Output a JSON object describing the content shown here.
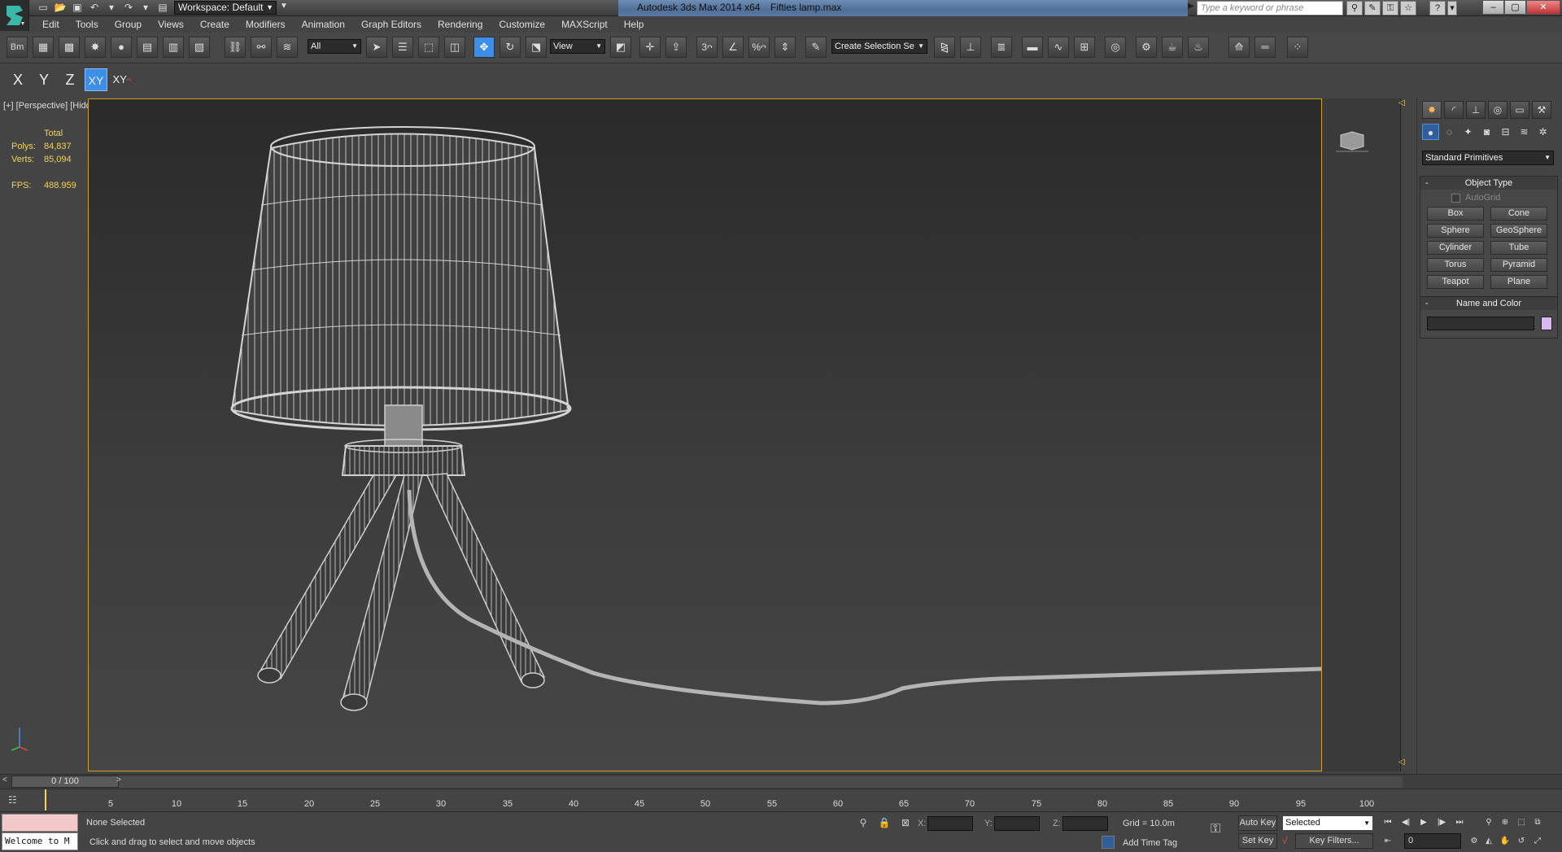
{
  "title_bar": {
    "workspace_label": "Workspace: Default",
    "app_title": "Autodesk 3ds Max  2014 x64",
    "file_title": "Fifties lamp.max",
    "search_placeholder": "Type a keyword or phrase",
    "title_accent": "#5b7aa4"
  },
  "menu": {
    "items": [
      "Edit",
      "Tools",
      "Group",
      "Views",
      "Create",
      "Modifiers",
      "Animation",
      "Graph Editors",
      "Rendering",
      "Customize",
      "MAXScript",
      "Help"
    ]
  },
  "main_toolbar": {
    "selection_filter": "All",
    "reference_coord": "View",
    "named_selection": "Create Selection Se",
    "active_tool_color": "#3d8ee8"
  },
  "axis_constraints": {
    "x": "X",
    "y": "Y",
    "z": "Z",
    "xy": "XY",
    "xy_cycle": "XY"
  },
  "viewport": {
    "label": "[+] [Perspective] [Hidden Line]",
    "stats": {
      "header": "Total",
      "polys_label": "Polys:",
      "polys_value": "84,837",
      "verts_label": "Verts:",
      "verts_value": "85,094",
      "fps_label": "FPS:",
      "fps_value": "488.959"
    },
    "border_color": "#c9a227",
    "stats_color": "#f2d25c"
  },
  "command_panel": {
    "category_dropdown": "Standard Primitives",
    "object_type": {
      "title": "Object Type",
      "autogrid_label": "AutoGrid",
      "buttons": [
        "Box",
        "Cone",
        "Sphere",
        "GeoSphere",
        "Cylinder",
        "Tube",
        "Torus",
        "Pyramid",
        "Teapot",
        "Plane"
      ]
    },
    "name_and_color": {
      "title": "Name and Color",
      "swatch_color": "#d9b8f2"
    }
  },
  "timeline": {
    "slider_label": "0 / 100",
    "ticks": [
      "5",
      "10",
      "15",
      "20",
      "25",
      "30",
      "35",
      "40",
      "45",
      "50",
      "55",
      "60",
      "65",
      "70",
      "75",
      "80",
      "85",
      "90",
      "95",
      "100"
    ]
  },
  "status_bar": {
    "maxscript_listener": "Welcome to M",
    "selection_status": "None Selected",
    "prompt": "Click and drag to select and move objects",
    "x_label": "X:",
    "y_label": "Y:",
    "z_label": "Z:",
    "grid": "Grid = 10.0m",
    "add_time_tag": "Add Time Tag",
    "auto_key": "Auto Key",
    "set_key": "Set Key",
    "key_mode": "Selected",
    "key_filters": "Key Filters...",
    "current_frame": "0"
  }
}
